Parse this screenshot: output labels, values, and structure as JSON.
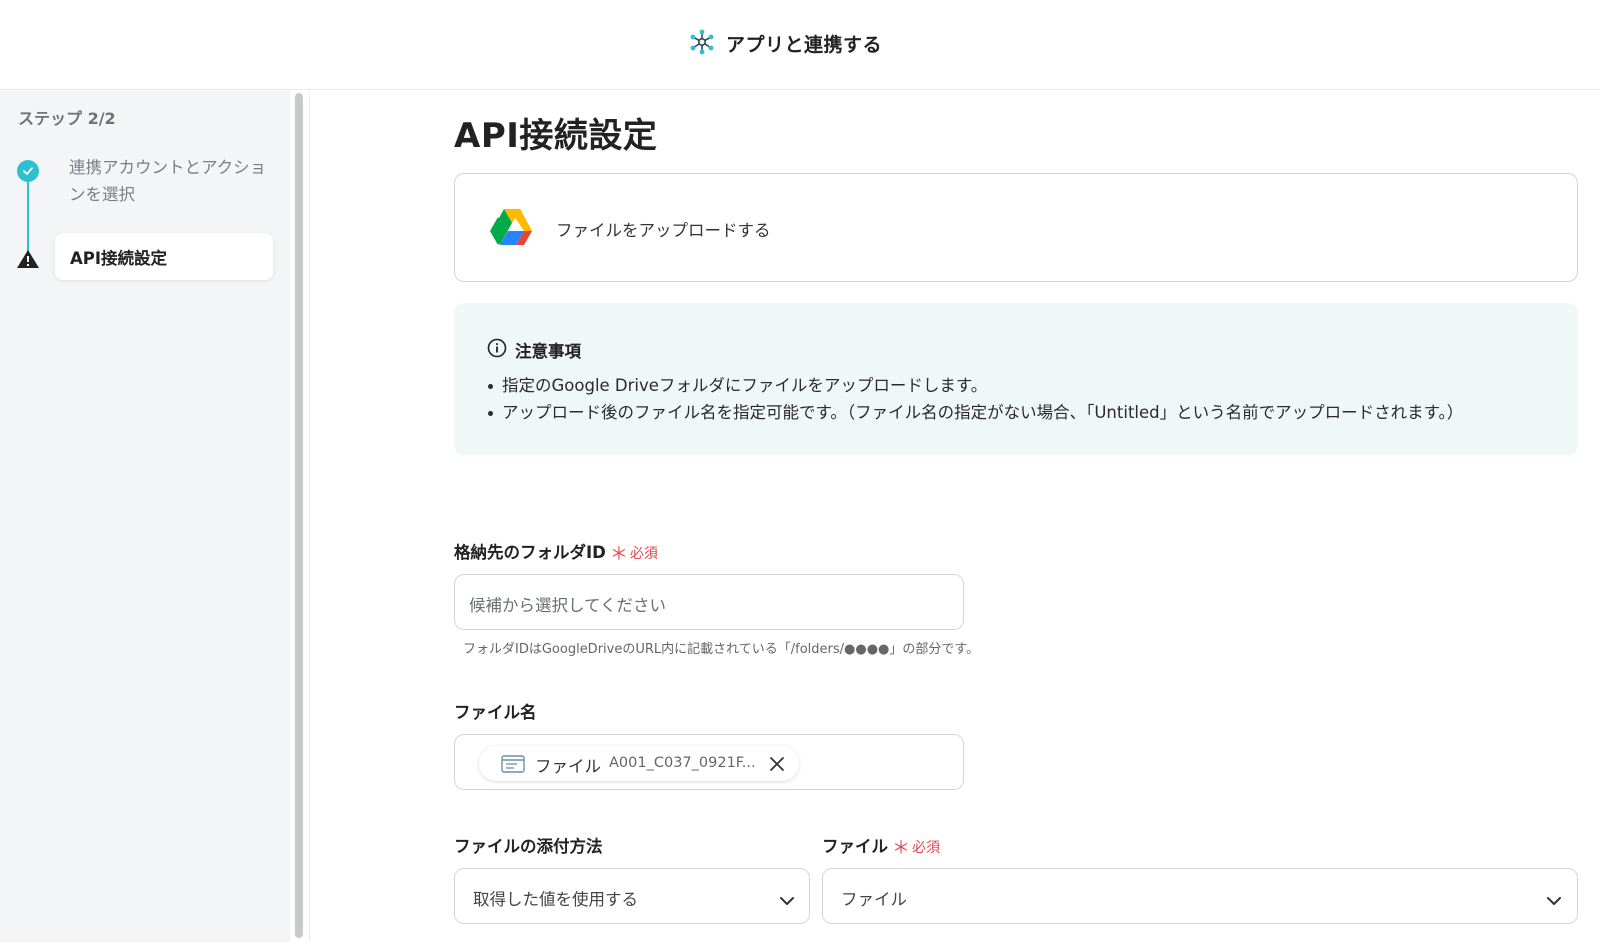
{
  "header": {
    "title": "アプリと連携する",
    "icon": "network-hub-icon"
  },
  "sidebar": {
    "step_count": "ステップ 2/2",
    "steps": [
      {
        "label": "連携アカウントとアクションを選択",
        "status": "completed",
        "icon": "check-circle-icon"
      },
      {
        "label": "API接続設定",
        "status": "current",
        "icon": "warning-triangle-icon"
      }
    ]
  },
  "main": {
    "page_title": "API接続設定",
    "action": {
      "label": "ファイルをアップロードする",
      "app_icon": "google-drive-logo"
    },
    "notice": {
      "title": "注意事項",
      "items": [
        "指定のGoogle Driveフォルダにファイルをアップロードします。",
        "アップロード後のファイル名を指定可能です。（ファイル名の指定がない場合、「Untitled」という名前でアップロードされます。）"
      ]
    },
    "fields": {
      "folder_id": {
        "label": "格納先のフォルダID",
        "required_mark": "＊",
        "required_text": "必須",
        "placeholder": "候補から選択してください",
        "hint": "フォルダIDはGoogleDriveのURL内に記載されている「/folders/●●●●」の部分です。"
      },
      "file_name": {
        "label": "ファイル名",
        "chip": {
          "type": "ファイル",
          "value": "A001_C037_0921F..."
        }
      },
      "attach_method": {
        "label": "ファイルの添付方法",
        "value": "取得した値を使用する"
      },
      "file": {
        "label": "ファイル",
        "required_mark": "＊",
        "required_text": "必須",
        "value": "ファイル"
      }
    }
  },
  "colors": {
    "accent": "#2fbfd0",
    "required": "#e5484d",
    "notice_bg": "#eff8f7",
    "sidebar_bg": "#f4f5f7"
  }
}
